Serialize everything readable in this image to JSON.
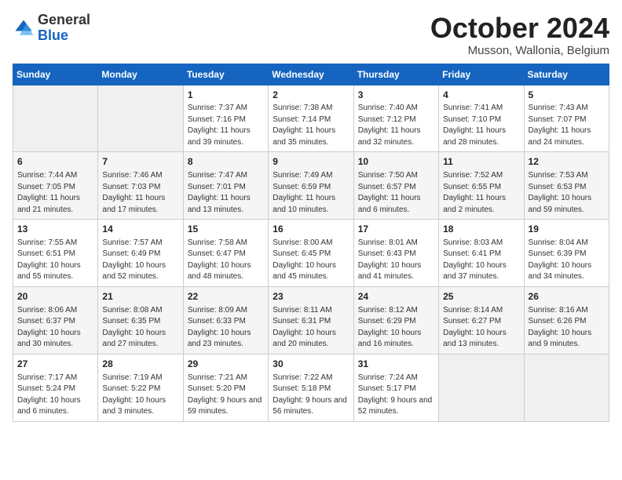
{
  "header": {
    "logo_general": "General",
    "logo_blue": "Blue",
    "month_title": "October 2024",
    "location": "Musson, Wallonia, Belgium"
  },
  "columns": [
    "Sunday",
    "Monday",
    "Tuesday",
    "Wednesday",
    "Thursday",
    "Friday",
    "Saturday"
  ],
  "weeks": [
    [
      {
        "day": "",
        "sunrise": "",
        "sunset": "",
        "daylight": ""
      },
      {
        "day": "",
        "sunrise": "",
        "sunset": "",
        "daylight": ""
      },
      {
        "day": "1",
        "sunrise": "Sunrise: 7:37 AM",
        "sunset": "Sunset: 7:16 PM",
        "daylight": "Daylight: 11 hours and 39 minutes."
      },
      {
        "day": "2",
        "sunrise": "Sunrise: 7:38 AM",
        "sunset": "Sunset: 7:14 PM",
        "daylight": "Daylight: 11 hours and 35 minutes."
      },
      {
        "day": "3",
        "sunrise": "Sunrise: 7:40 AM",
        "sunset": "Sunset: 7:12 PM",
        "daylight": "Daylight: 11 hours and 32 minutes."
      },
      {
        "day": "4",
        "sunrise": "Sunrise: 7:41 AM",
        "sunset": "Sunset: 7:10 PM",
        "daylight": "Daylight: 11 hours and 28 minutes."
      },
      {
        "day": "5",
        "sunrise": "Sunrise: 7:43 AM",
        "sunset": "Sunset: 7:07 PM",
        "daylight": "Daylight: 11 hours and 24 minutes."
      }
    ],
    [
      {
        "day": "6",
        "sunrise": "Sunrise: 7:44 AM",
        "sunset": "Sunset: 7:05 PM",
        "daylight": "Daylight: 11 hours and 21 minutes."
      },
      {
        "day": "7",
        "sunrise": "Sunrise: 7:46 AM",
        "sunset": "Sunset: 7:03 PM",
        "daylight": "Daylight: 11 hours and 17 minutes."
      },
      {
        "day": "8",
        "sunrise": "Sunrise: 7:47 AM",
        "sunset": "Sunset: 7:01 PM",
        "daylight": "Daylight: 11 hours and 13 minutes."
      },
      {
        "day": "9",
        "sunrise": "Sunrise: 7:49 AM",
        "sunset": "Sunset: 6:59 PM",
        "daylight": "Daylight: 11 hours and 10 minutes."
      },
      {
        "day": "10",
        "sunrise": "Sunrise: 7:50 AM",
        "sunset": "Sunset: 6:57 PM",
        "daylight": "Daylight: 11 hours and 6 minutes."
      },
      {
        "day": "11",
        "sunrise": "Sunrise: 7:52 AM",
        "sunset": "Sunset: 6:55 PM",
        "daylight": "Daylight: 11 hours and 2 minutes."
      },
      {
        "day": "12",
        "sunrise": "Sunrise: 7:53 AM",
        "sunset": "Sunset: 6:53 PM",
        "daylight": "Daylight: 10 hours and 59 minutes."
      }
    ],
    [
      {
        "day": "13",
        "sunrise": "Sunrise: 7:55 AM",
        "sunset": "Sunset: 6:51 PM",
        "daylight": "Daylight: 10 hours and 55 minutes."
      },
      {
        "day": "14",
        "sunrise": "Sunrise: 7:57 AM",
        "sunset": "Sunset: 6:49 PM",
        "daylight": "Daylight: 10 hours and 52 minutes."
      },
      {
        "day": "15",
        "sunrise": "Sunrise: 7:58 AM",
        "sunset": "Sunset: 6:47 PM",
        "daylight": "Daylight: 10 hours and 48 minutes."
      },
      {
        "day": "16",
        "sunrise": "Sunrise: 8:00 AM",
        "sunset": "Sunset: 6:45 PM",
        "daylight": "Daylight: 10 hours and 45 minutes."
      },
      {
        "day": "17",
        "sunrise": "Sunrise: 8:01 AM",
        "sunset": "Sunset: 6:43 PM",
        "daylight": "Daylight: 10 hours and 41 minutes."
      },
      {
        "day": "18",
        "sunrise": "Sunrise: 8:03 AM",
        "sunset": "Sunset: 6:41 PM",
        "daylight": "Daylight: 10 hours and 37 minutes."
      },
      {
        "day": "19",
        "sunrise": "Sunrise: 8:04 AM",
        "sunset": "Sunset: 6:39 PM",
        "daylight": "Daylight: 10 hours and 34 minutes."
      }
    ],
    [
      {
        "day": "20",
        "sunrise": "Sunrise: 8:06 AM",
        "sunset": "Sunset: 6:37 PM",
        "daylight": "Daylight: 10 hours and 30 minutes."
      },
      {
        "day": "21",
        "sunrise": "Sunrise: 8:08 AM",
        "sunset": "Sunset: 6:35 PM",
        "daylight": "Daylight: 10 hours and 27 minutes."
      },
      {
        "day": "22",
        "sunrise": "Sunrise: 8:09 AM",
        "sunset": "Sunset: 6:33 PM",
        "daylight": "Daylight: 10 hours and 23 minutes."
      },
      {
        "day": "23",
        "sunrise": "Sunrise: 8:11 AM",
        "sunset": "Sunset: 6:31 PM",
        "daylight": "Daylight: 10 hours and 20 minutes."
      },
      {
        "day": "24",
        "sunrise": "Sunrise: 8:12 AM",
        "sunset": "Sunset: 6:29 PM",
        "daylight": "Daylight: 10 hours and 16 minutes."
      },
      {
        "day": "25",
        "sunrise": "Sunrise: 8:14 AM",
        "sunset": "Sunset: 6:27 PM",
        "daylight": "Daylight: 10 hours and 13 minutes."
      },
      {
        "day": "26",
        "sunrise": "Sunrise: 8:16 AM",
        "sunset": "Sunset: 6:26 PM",
        "daylight": "Daylight: 10 hours and 9 minutes."
      }
    ],
    [
      {
        "day": "27",
        "sunrise": "Sunrise: 7:17 AM",
        "sunset": "Sunset: 5:24 PM",
        "daylight": "Daylight: 10 hours and 6 minutes."
      },
      {
        "day": "28",
        "sunrise": "Sunrise: 7:19 AM",
        "sunset": "Sunset: 5:22 PM",
        "daylight": "Daylight: 10 hours and 3 minutes."
      },
      {
        "day": "29",
        "sunrise": "Sunrise: 7:21 AM",
        "sunset": "Sunset: 5:20 PM",
        "daylight": "Daylight: 9 hours and 59 minutes."
      },
      {
        "day": "30",
        "sunrise": "Sunrise: 7:22 AM",
        "sunset": "Sunset: 5:18 PM",
        "daylight": "Daylight: 9 hours and 56 minutes."
      },
      {
        "day": "31",
        "sunrise": "Sunrise: 7:24 AM",
        "sunset": "Sunset: 5:17 PM",
        "daylight": "Daylight: 9 hours and 52 minutes."
      },
      {
        "day": "",
        "sunrise": "",
        "sunset": "",
        "daylight": ""
      },
      {
        "day": "",
        "sunrise": "",
        "sunset": "",
        "daylight": ""
      }
    ]
  ]
}
